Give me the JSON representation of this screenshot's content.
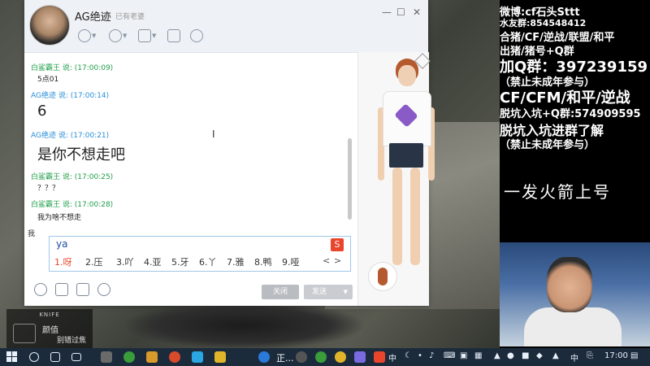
{
  "chat_window": {
    "contact_name": "AG绝迹",
    "status": "已有老婆",
    "messages": [
      {
        "sender": "白鲨霸王 说: (17:00:09)",
        "text": "5点01",
        "size": "small",
        "color": "green"
      },
      {
        "sender": "AG绝迹 说: (17:00:14)",
        "text": "6",
        "size": "large",
        "color": "blue"
      },
      {
        "sender": "AG绝迹 说: (17:00:21)",
        "text": "是你不想走吧",
        "size": "large",
        "color": "blue"
      },
      {
        "sender": "白鲨霸王 说: (17:00:25)",
        "text": "？？？",
        "size": "small",
        "color": "green"
      },
      {
        "sender": "白鲨霸王 说: (17:00:28)",
        "text": "我为啥不想走",
        "size": "small",
        "color": "green"
      }
    ],
    "input_label": "我",
    "input_value": "ya",
    "ime_candidates": [
      "1.呀",
      "2.压",
      "3.吖",
      "4.亚",
      "5.牙",
      "6.丫",
      "7.雅",
      "8.鸭",
      "9.哑"
    ],
    "ime_prev": "<",
    "ime_next": ">",
    "close_button": "关闭",
    "send_button": "发送"
  },
  "game_hud": {
    "weapon_title": "KNIFE",
    "line1": "颜值",
    "line2": "别错过焦"
  },
  "stream_overlay": {
    "lines": [
      "微博:cf石头Sttt",
      "水友群:854548412",
      "合猪/CF/逆战/联盟/和平",
      "出猪/猪号+Q群",
      "加Q群：397239159",
      "（禁止未成年参与）",
      "CF/CFM/和平/逆战",
      "脱坑入坑+Q群:574909595",
      "脱坑入坑进群了解",
      "（禁止未成年参与）"
    ],
    "slogan": "一发火箭上号"
  },
  "taskbar": {
    "app_label": "正...",
    "ime_label": "中",
    "ime_label2": "中",
    "clock": "17:00"
  },
  "colors": {
    "taskbar": "#1c2b3c",
    "sender_blue": "#2a8fd6",
    "sender_green": "#1f9e4a",
    "ime_selected": "#e8452c"
  }
}
